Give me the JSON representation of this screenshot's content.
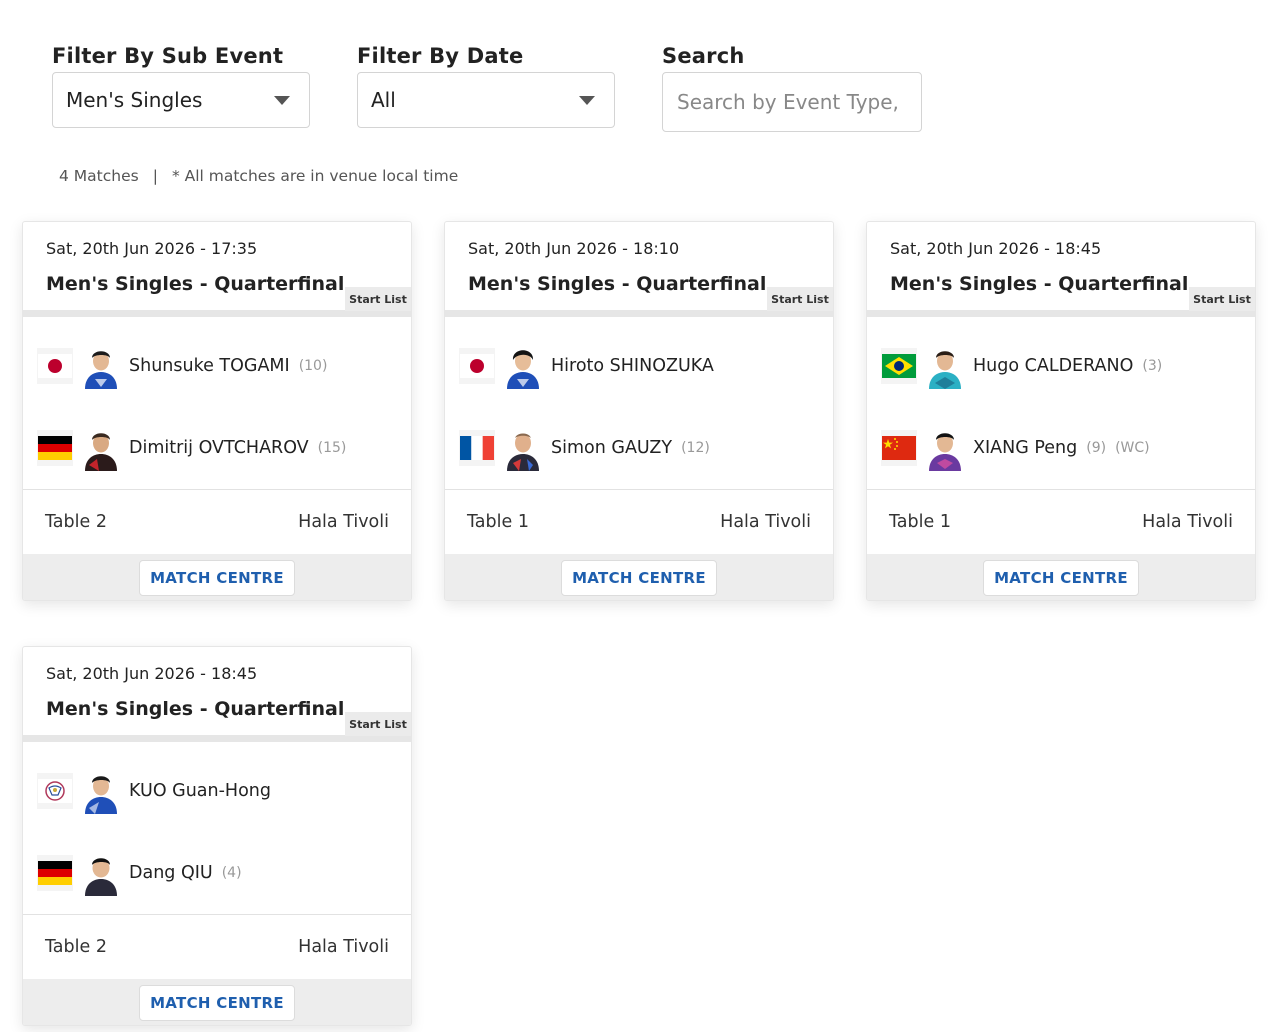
{
  "filters": {
    "sub_event": {
      "label": "Filter By Sub Event",
      "value": "Men's Singles"
    },
    "date": {
      "label": "Filter By Date",
      "value": "All"
    },
    "search": {
      "label": "Search",
      "placeholder": "Search by Event Type, Player"
    }
  },
  "meta": {
    "match_count": "4 Matches",
    "separator": "|",
    "timezone_note": "* All matches are in venue local time"
  },
  "matches": [
    {
      "datetime": "Sat, 20th Jun 2026 - 17:35",
      "title": "Men's Singles - Quarterfinal",
      "start_list_label": "Start List",
      "players": [
        {
          "country": "Japan",
          "flag_icon": "japan-flag-icon",
          "name": "Shunsuke TOGAMI",
          "seed": "(10)",
          "extra": ""
        },
        {
          "country": "Germany",
          "flag_icon": "germany-flag-icon",
          "name": "Dimitrij OVTCHAROV",
          "seed": "(15)",
          "extra": ""
        }
      ],
      "table": "Table 2",
      "venue": "Hala Tivoli",
      "button_label": "MATCH CENTRE"
    },
    {
      "datetime": "Sat, 20th Jun 2026 - 18:10",
      "title": "Men's Singles - Quarterfinal",
      "start_list_label": "Start List",
      "players": [
        {
          "country": "Japan",
          "flag_icon": "japan-flag-icon",
          "name": "Hiroto SHINOZUKA",
          "seed": "",
          "extra": ""
        },
        {
          "country": "France",
          "flag_icon": "france-flag-icon",
          "name": "Simon GAUZY",
          "seed": "(12)",
          "extra": ""
        }
      ],
      "table": "Table 1",
      "venue": "Hala Tivoli",
      "button_label": "MATCH CENTRE"
    },
    {
      "datetime": "Sat, 20th Jun 2026 - 18:45",
      "title": "Men's Singles - Quarterfinal",
      "start_list_label": "Start List",
      "players": [
        {
          "country": "Brazil",
          "flag_icon": "brazil-flag-icon",
          "name": "Hugo CALDERANO",
          "seed": "(3)",
          "extra": ""
        },
        {
          "country": "China",
          "flag_icon": "china-flag-icon",
          "name": "XIANG Peng",
          "seed": "(9)",
          "extra": "(WC)"
        }
      ],
      "table": "Table 1",
      "venue": "Hala Tivoli",
      "button_label": "MATCH CENTRE"
    },
    {
      "datetime": "Sat, 20th Jun 2026 - 18:45",
      "title": "Men's Singles - Quarterfinal",
      "start_list_label": "Start List",
      "players": [
        {
          "country": "Chinese Taipei",
          "flag_icon": "chinese-taipei-flag-icon",
          "name": "KUO Guan-Hong",
          "seed": "",
          "extra": ""
        },
        {
          "country": "Germany",
          "flag_icon": "germany-flag-icon",
          "name": "Dang QIU",
          "seed": "(4)",
          "extra": ""
        }
      ],
      "table": "Table 2",
      "venue": "Hala Tivoli",
      "button_label": "MATCH CENTRE"
    }
  ],
  "colors": {
    "button_text": "#1f5fae",
    "japan_red": "#bc002d",
    "germany_black": "#000000",
    "germany_red": "#dd0000",
    "germany_gold": "#ffce00",
    "france_blue": "#0055a4",
    "france_red": "#ef4135",
    "brazil_green": "#009c3b",
    "brazil_yellow": "#ffdf00",
    "brazil_blue": "#002776",
    "china_red": "#de2910",
    "china_yellow": "#ffde00"
  }
}
